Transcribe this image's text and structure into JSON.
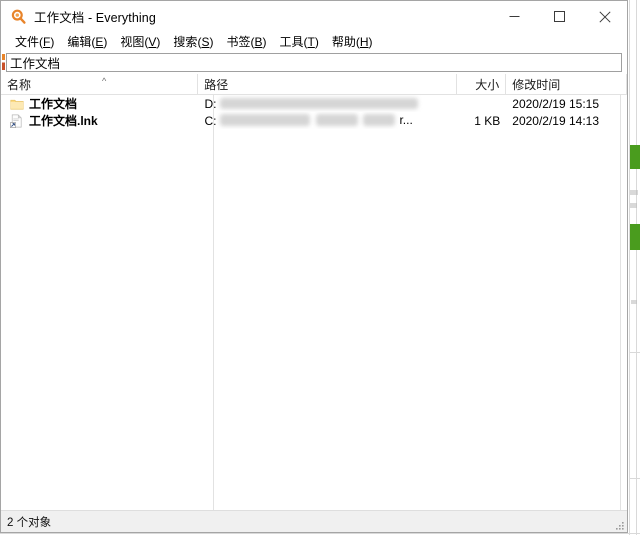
{
  "window": {
    "title": "工作文档 - Everything",
    "icon": "magnifier-icon",
    "controls": {
      "minimize_label": "最小化",
      "maximize_label": "最大化",
      "close_label": "关闭"
    }
  },
  "menu": {
    "items": [
      {
        "name": "文件",
        "accel": "F"
      },
      {
        "name": "编辑",
        "accel": "E"
      },
      {
        "name": "视图",
        "accel": "V"
      },
      {
        "name": "搜索",
        "accel": "S"
      },
      {
        "name": "书签",
        "accel": "B"
      },
      {
        "name": "工具",
        "accel": "T"
      },
      {
        "name": "帮助",
        "accel": "H"
      }
    ]
  },
  "search": {
    "value": "工作文档",
    "placeholder": ""
  },
  "results": {
    "columns": [
      {
        "key": "name",
        "label": "名称",
        "sorted": true,
        "sort_direction": "asc",
        "sort_glyph": "^"
      },
      {
        "key": "path",
        "label": "路径",
        "sorted": false
      },
      {
        "key": "size",
        "label": "大小",
        "sorted": false,
        "align": "right"
      },
      {
        "key": "date",
        "label": "修改时间",
        "sorted": false
      }
    ],
    "rows": [
      {
        "icon": "folder-icon",
        "name": "工作文档",
        "path": "D:",
        "path_redacted": true,
        "size": "",
        "date": "2020/2/19 15:15"
      },
      {
        "icon": "shortcut-file-icon",
        "name": "工作文档.lnk",
        "path": "C:",
        "path_redacted": true,
        "path_tail": "r...",
        "size": "1 KB",
        "date": "2020/2/19 14:13"
      }
    ]
  },
  "status": {
    "text": "2 个对象"
  },
  "colors": {
    "accent_orange": "#e8842a",
    "folder_yellow": "#fcd97f",
    "background_green": "#4a9c1e",
    "window_border": "#a5a5a5",
    "status_bar": "#f0f0f0"
  }
}
